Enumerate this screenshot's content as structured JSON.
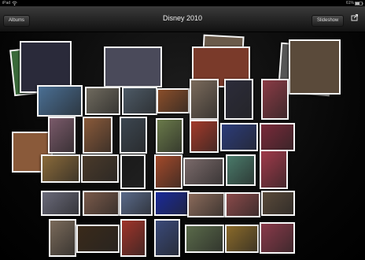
{
  "status_bar": {
    "carrier": "iPad",
    "battery": "61%"
  },
  "nav_bar": {
    "back_label": "Albums",
    "title": "Disney 2010",
    "slideshow_label": "Slideshow"
  },
  "icons": {
    "share": "share-icon",
    "wifi": "wifi-icon",
    "battery": "battery-icon"
  },
  "albums": [
    {
      "label": ""
    },
    {
      "label": ""
    },
    {
      "label": ""
    },
    {
      "label": ""
    },
    {
      "label": ""
    }
  ],
  "photos": [
    {
      "c": "#4a6f94"
    },
    {
      "c": "#6f6a5e"
    },
    {
      "c": "#4d5a66"
    },
    {
      "c": "#8a4e2a"
    },
    {
      "c": "#7a6a5b"
    },
    {
      "c": "#2c2c3a"
    },
    {
      "c": "#8a3b45"
    },
    {
      "c": "#7a5a6a"
    },
    {
      "c": "#8a5a3a"
    },
    {
      "c": "#3c4650"
    },
    {
      "c": "#6a7a4a"
    },
    {
      "c": "#a33a2a"
    },
    {
      "c": "#2c3c7a"
    },
    {
      "c": "#7a2a3a"
    },
    {
      "c": "#8a6a3a"
    },
    {
      "c": "#4a3a2a"
    },
    {
      "c": "#1a1a1a"
    },
    {
      "c": "#a34a2a"
    },
    {
      "c": "#7a6a6a"
    },
    {
      "c": "#4a7a6a"
    },
    {
      "c": "#a03a4a"
    },
    {
      "c": "#6a6a7a"
    },
    {
      "c": "#7a5a4a"
    },
    {
      "c": "#5a6a8a"
    },
    {
      "c": "#1a2a9a"
    },
    {
      "c": "#8a6a5a"
    },
    {
      "c": "#8a4a4a"
    },
    {
      "c": "#5a4a3a"
    },
    {
      "c": "#7a6a5a"
    },
    {
      "c": "#3a2a1a"
    },
    {
      "c": "#a0342a"
    },
    {
      "c": "#3a4a7a"
    },
    {
      "c": "#5a6a4a"
    },
    {
      "c": "#8a6a2a"
    },
    {
      "c": "#8a3a4a"
    }
  ]
}
